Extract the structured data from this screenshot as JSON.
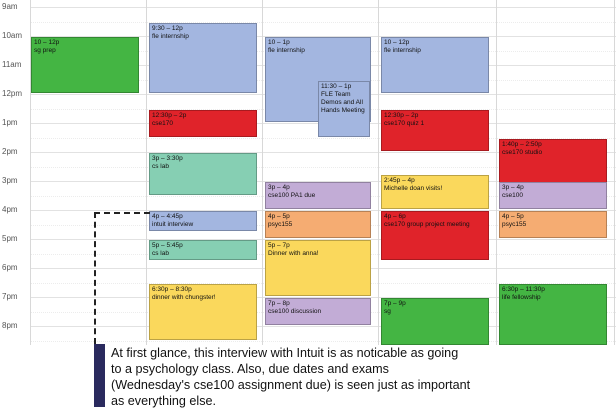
{
  "hours": [
    {
      "label": "9am",
      "idx": 0
    },
    {
      "label": "10am",
      "idx": 1
    },
    {
      "label": "11am",
      "idx": 2
    },
    {
      "label": "12pm",
      "idx": 3
    },
    {
      "label": "1pm",
      "idx": 4
    },
    {
      "label": "2pm",
      "idx": 5
    },
    {
      "label": "3pm",
      "idx": 6
    },
    {
      "label": "4pm",
      "idx": 7
    },
    {
      "label": "5pm",
      "idx": 8
    },
    {
      "label": "6pm",
      "idx": 9
    },
    {
      "label": "7pm",
      "idx": 10
    },
    {
      "label": "8pm",
      "idx": 11
    }
  ],
  "colors": {
    "green": "#44b543",
    "blue": "#a3b6e0",
    "red": "#e0232a",
    "teal": "#86cfb3",
    "purple": "#c2acd6",
    "orange": "#f5ac72",
    "yellow": "#fad85c"
  },
  "events": [
    {
      "day": 0,
      "start": 10,
      "end": 12,
      "time": "10 – 12p",
      "title": "sg prep",
      "color": "green"
    },
    {
      "day": 1,
      "start": 9.5,
      "end": 12,
      "time": "9:30 – 12p",
      "title": "fle internship",
      "color": "blue"
    },
    {
      "day": 1,
      "start": 12.5,
      "end": 13.5,
      "time": "12:30p – 2p",
      "title": "cse170",
      "color": "red"
    },
    {
      "day": 1,
      "start": 14,
      "end": 15.5,
      "time": "3p – 3:30p",
      "title": "cs lab",
      "color": "teal"
    },
    {
      "day": 1,
      "start": 16,
      "end": 16.75,
      "time": "4p – 4:45p",
      "title": "intuit interview",
      "color": "blue"
    },
    {
      "day": 1,
      "start": 17,
      "end": 17.75,
      "time": "5p – 5:45p",
      "title": "cs lab",
      "color": "teal"
    },
    {
      "day": 1,
      "start": 18.5,
      "end": 20.5,
      "time": "6:30p – 8:30p",
      "title": "dinner with chungster!",
      "color": "yellow"
    },
    {
      "day": 2,
      "start": 10,
      "end": 13,
      "time": "10 – 1p",
      "title": "fle internship",
      "color": "blue"
    },
    {
      "day": 2,
      "start": 11.5,
      "end": 13.5,
      "time": "11:30 – 1p",
      "title": "FLE Team Demos and All Hands Meeting",
      "color": "blue",
      "sub": true
    },
    {
      "day": 2,
      "start": 15,
      "end": 16,
      "time": "3p – 4p",
      "title": "cse100 PA1 due",
      "color": "purple"
    },
    {
      "day": 2,
      "start": 16,
      "end": 17,
      "time": "4p – 5p",
      "title": "psyc155",
      "color": "orange"
    },
    {
      "day": 2,
      "start": 17,
      "end": 19,
      "time": "5p – 7p",
      "title": "Dinner with anna!",
      "color": "yellow"
    },
    {
      "day": 2,
      "start": 19,
      "end": 20,
      "time": "7p – 8p",
      "title": "cse100 discussion",
      "color": "purple"
    },
    {
      "day": 3,
      "start": 10,
      "end": 12,
      "time": "10 – 12p",
      "title": "fle internship",
      "color": "blue"
    },
    {
      "day": 3,
      "start": 12.5,
      "end": 14,
      "time": "12:30p – 2p",
      "title": "cse170 quiz 1",
      "color": "red"
    },
    {
      "day": 3,
      "start": 14.75,
      "end": 16,
      "time": "2:45p – 4p",
      "title": "Michelle doan visits!",
      "color": "yellow"
    },
    {
      "day": 3,
      "start": 16,
      "end": 17.75,
      "time": "4p – 6p",
      "title": "cse170 group project meeting",
      "color": "red"
    },
    {
      "day": 3,
      "start": 19,
      "end": 21,
      "time": "7p – 9p",
      "title": "sg",
      "color": "green"
    },
    {
      "day": 4,
      "start": 13.5,
      "end": 15.5,
      "time": "1:40p – 2:50p",
      "title": "cse170 studio",
      "color": "red"
    },
    {
      "day": 4,
      "start": 15,
      "end": 16,
      "time": "3p – 4p",
      "title": "cse100",
      "color": "purple"
    },
    {
      "day": 4,
      "start": 16,
      "end": 17,
      "time": "4p – 5p",
      "title": "psyc155",
      "color": "orange"
    },
    {
      "day": 4,
      "start": 18.5,
      "end": 21,
      "time": "6:30p – 11:30p",
      "title": "life fellowship",
      "color": "green"
    }
  ],
  "annotation": {
    "text": "At first glance, this interview with Intuit is as noticable as going to a psychology class.   Also, due dates and exams (Wednesday's cse100 assignment due) is seen just as important as everything else."
  }
}
